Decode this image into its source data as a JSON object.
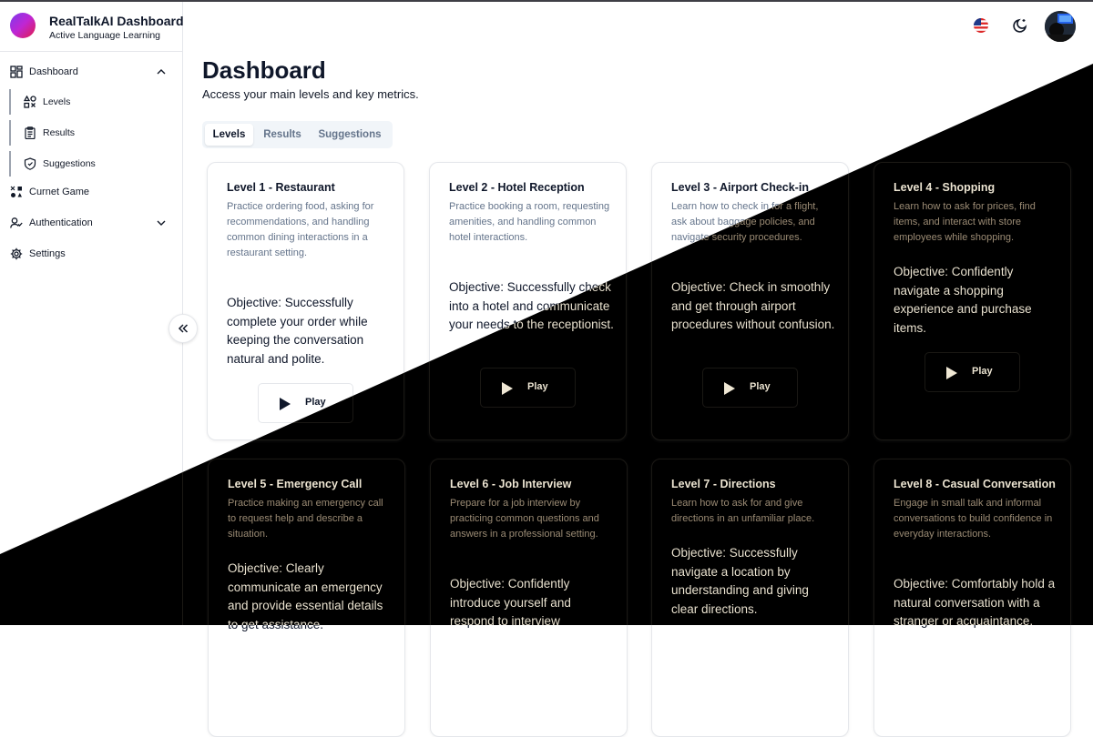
{
  "app": {
    "title": "RealTalkAI Dashboard",
    "subtitle": "Active Language Learning"
  },
  "sidebar": {
    "items": [
      {
        "label": "Dashboard",
        "icon": "dashboard-icon"
      },
      {
        "label": "Levels",
        "icon": "shapes-icon"
      },
      {
        "label": "Results",
        "icon": "clipboard-icon"
      },
      {
        "label": "Suggestions",
        "icon": "shield-icon"
      },
      {
        "label": "Curnet Game",
        "icon": "gamepad-icon"
      },
      {
        "label": "Authentication",
        "icon": "user-check-icon"
      },
      {
        "label": "Settings",
        "icon": "gear-icon"
      }
    ]
  },
  "header": {
    "language_icon": "us-flag-icon",
    "theme_icon": "moon-icon",
    "avatar_icon": "user-avatar"
  },
  "main": {
    "title": "Dashboard",
    "subtitle": "Access your main levels and key metrics.",
    "tabs": [
      "Levels",
      "Results",
      "Suggestions"
    ],
    "active_tab": "Levels",
    "play_label": "Play",
    "levels": [
      {
        "title": "Level 1 - Restaurant",
        "description": "Practice ordering food, asking for recommendations, and handling common dining interactions in a restaurant setting.",
        "objective": "Objective: Successfully complete your order while keeping the conversation natural and polite."
      },
      {
        "title": "Level 2 - Hotel Reception",
        "description": "Practice booking a room, requesting amenities, and handling common hotel interactions.",
        "objective": "Objective: Successfully check into a hotel and communicate your needs to the receptionist."
      },
      {
        "title": "Level 3 - Airport Check-in",
        "description": "Learn how to check in for a flight, ask about baggage policies, and navigate security procedures.",
        "objective": "Objective: Check in smoothly and get through airport procedures without confusion."
      },
      {
        "title": "Level 4 - Shopping",
        "description": "Learn how to ask for prices, find items, and interact with store employees while shopping.",
        "objective": "Objective: Confidently navigate a shopping experience and purchase items."
      },
      {
        "title": "Level 5 - Emergency Call",
        "description": "Practice making an emergency call to request help and describe a situation.",
        "objective": "Objective: Clearly communicate an emergency and provide essential details to get assistance."
      },
      {
        "title": "Level 6 - Job Interview",
        "description": "Prepare for a job interview by practicing common questions and answers in a professional setting.",
        "objective": "Objective: Confidently introduce yourself and respond to interview"
      },
      {
        "title": "Level 7 - Directions",
        "description": "Learn how to ask for and give directions in an unfamiliar place.",
        "objective": "Objective: Successfully navigate a location by understanding and giving clear directions."
      },
      {
        "title": "Level 8 - Casual Conversation",
        "description": "Engage in small talk and informal conversations to build confidence in everyday interactions.",
        "objective": "Objective: Comfortably hold a natural conversation with a stranger or acquaintance."
      }
    ]
  },
  "colors": {
    "dark_theme_bg": "#000000",
    "dark_card_bg": "#0a0b14",
    "accent_gradient": [
      "#7c3aed",
      "#e11d48"
    ]
  }
}
